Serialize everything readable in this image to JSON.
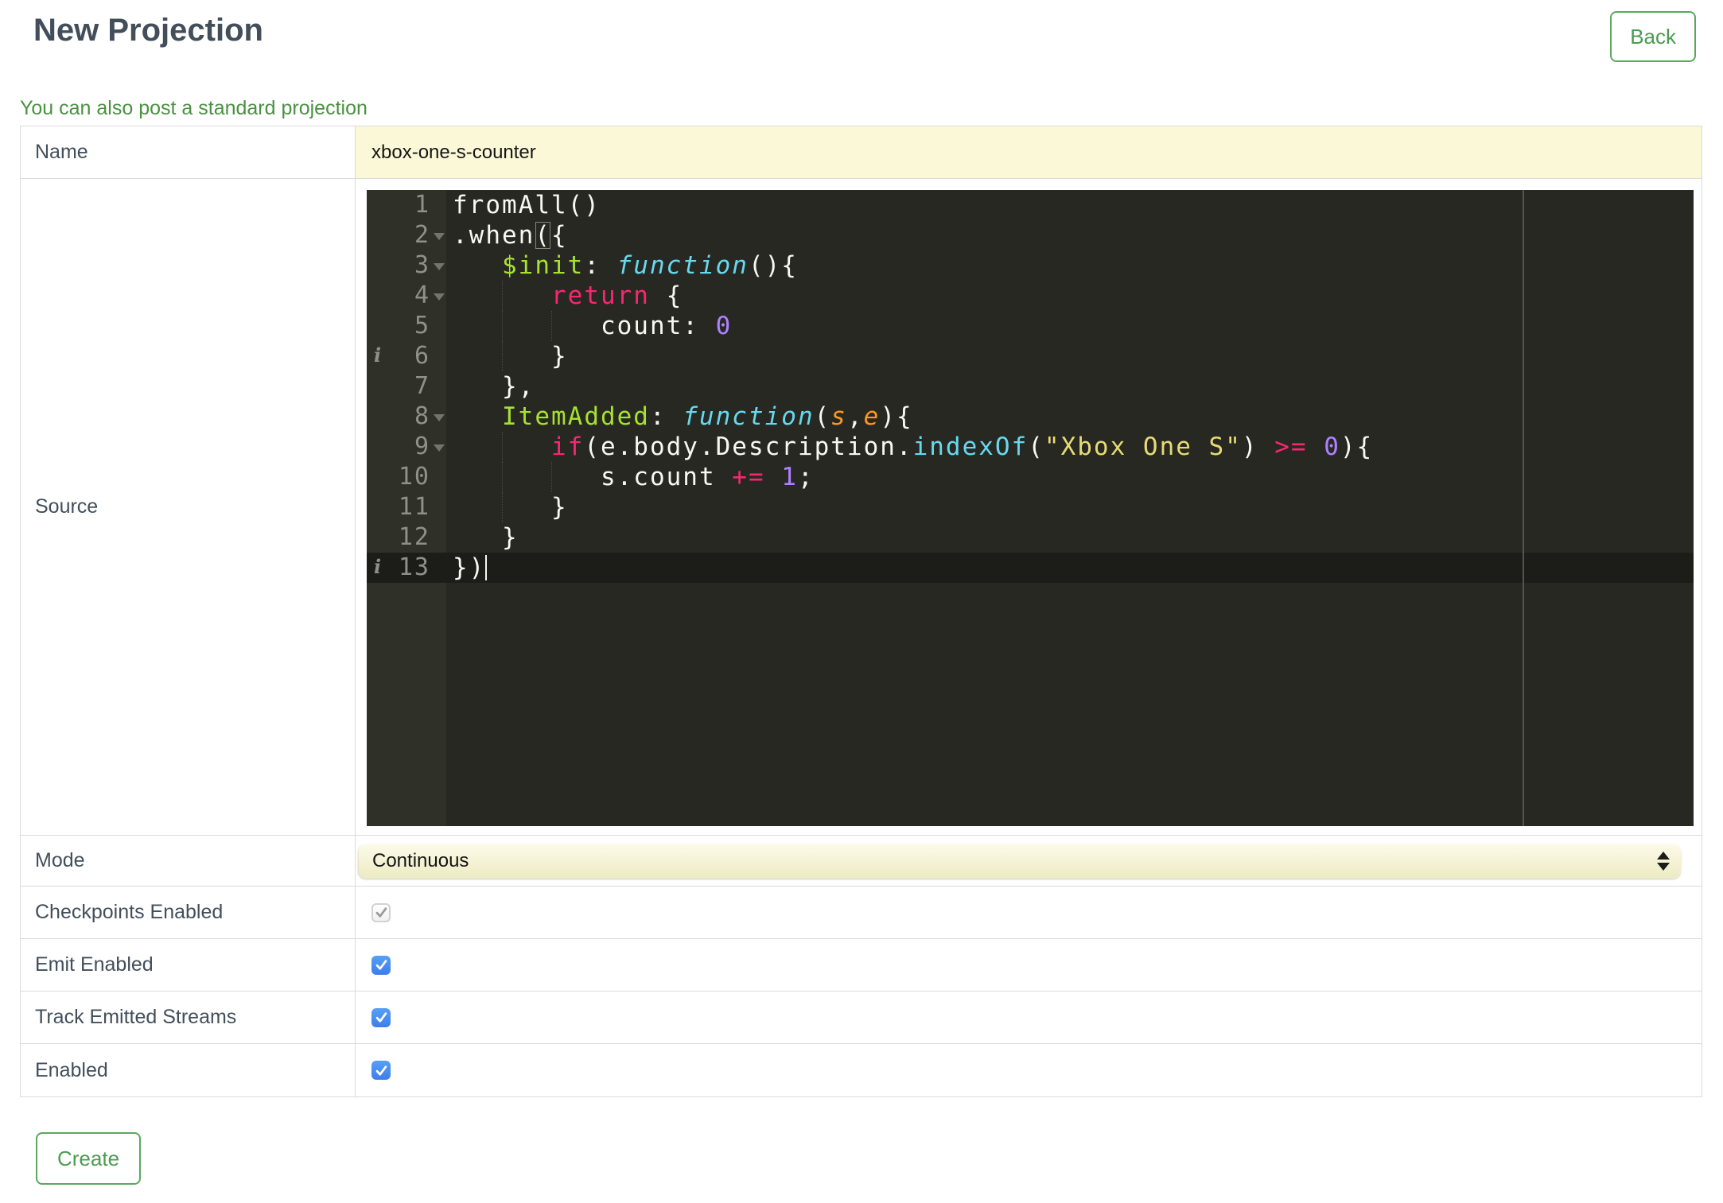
{
  "header": {
    "title": "New Projection",
    "back_label": "Back"
  },
  "subtitle_link": "You can also post a standard projection",
  "form": {
    "name": {
      "label": "Name",
      "value": "xbox-one-s-counter"
    },
    "source": {
      "label": "Source"
    },
    "mode": {
      "label": "Mode",
      "value": "Continuous"
    },
    "checkboxes": [
      {
        "label": "Checkpoints Enabled",
        "checked": true,
        "disabled": true
      },
      {
        "label": "Emit Enabled",
        "checked": true,
        "disabled": false
      },
      {
        "label": "Track Emitted Streams",
        "checked": true,
        "disabled": false
      },
      {
        "label": "Enabled",
        "checked": true,
        "disabled": false
      }
    ],
    "create_label": "Create"
  },
  "editor": {
    "lines": [
      {
        "num": 1,
        "segments": [
          [
            "p",
            "fromAll()"
          ]
        ]
      },
      {
        "num": 2,
        "fold": true,
        "segments": [
          [
            "p",
            ".when"
          ],
          [
            "brk",
            "("
          ],
          [
            "p",
            "{"
          ]
        ]
      },
      {
        "num": 3,
        "fold": true,
        "segments": [
          [
            "p",
            "   "
          ],
          [
            "name",
            "$init"
          ],
          [
            "p",
            ": "
          ],
          [
            "fn",
            "function"
          ],
          [
            "p",
            "(){"
          ]
        ]
      },
      {
        "num": 4,
        "fold": true,
        "guides": [
          3
        ],
        "segments": [
          [
            "p",
            "      "
          ],
          [
            "kw",
            "return"
          ],
          [
            "p",
            " {"
          ]
        ]
      },
      {
        "num": 5,
        "guides": [
          3,
          6
        ],
        "segments": [
          [
            "p",
            "         count: "
          ],
          [
            "num",
            "0"
          ]
        ]
      },
      {
        "num": 6,
        "info": true,
        "guides": [
          3
        ],
        "segments": [
          [
            "p",
            "      }"
          ]
        ]
      },
      {
        "num": 7,
        "segments": [
          [
            "p",
            "   },"
          ]
        ]
      },
      {
        "num": 8,
        "fold": true,
        "segments": [
          [
            "p",
            "   "
          ],
          [
            "name",
            "ItemAdded"
          ],
          [
            "p",
            ": "
          ],
          [
            "fn",
            "function"
          ],
          [
            "p",
            "("
          ],
          [
            "arg",
            "s"
          ],
          [
            "p",
            ","
          ],
          [
            "arg",
            "e"
          ],
          [
            "p",
            "){"
          ]
        ]
      },
      {
        "num": 9,
        "fold": true,
        "guides": [
          3
        ],
        "segments": [
          [
            "p",
            "      "
          ],
          [
            "kw",
            "if"
          ],
          [
            "p",
            "(e.body.Description."
          ],
          [
            "sup",
            "indexOf"
          ],
          [
            "p",
            "("
          ],
          [
            "str",
            "\"Xbox One S\""
          ],
          [
            "p",
            ") "
          ],
          [
            "kw",
            ">="
          ],
          [
            "p",
            " "
          ],
          [
            "num",
            "0"
          ],
          [
            "p",
            "){"
          ]
        ]
      },
      {
        "num": 10,
        "guides": [
          3,
          6
        ],
        "segments": [
          [
            "p",
            "         s.count "
          ],
          [
            "kw",
            "+="
          ],
          [
            "p",
            " "
          ],
          [
            "num",
            "1"
          ],
          [
            "p",
            ";"
          ]
        ]
      },
      {
        "num": 11,
        "guides": [
          3
        ],
        "segments": [
          [
            "p",
            "      }"
          ]
        ]
      },
      {
        "num": 12,
        "segments": [
          [
            "p",
            "   }"
          ]
        ]
      },
      {
        "num": 13,
        "info": true,
        "active": true,
        "segments": [
          [
            "p",
            "})"
          ],
          [
            "cursor",
            ""
          ]
        ]
      }
    ]
  },
  "theme": {
    "heading": "#424F5B",
    "green": "#4C9B50",
    "green-border": "#5CA75F",
    "link-green": "#4A9142",
    "cell-border": "#DBDBDB",
    "input-yellow": "#FAF8D6",
    "select-top": "#FCFBEA",
    "select-bottom": "#EDEBC2",
    "cb-top": "#57A0F6",
    "cb-bottom": "#3D7DEC",
    "editor-bg": "#272822",
    "gutter-bg": "#2F3129",
    "gutter-fg": "#8F908A",
    "active-line": "#1C1D18",
    "print-margin": "#53544C",
    "tok-plain": "#F8F8F2",
    "tok-kw": "#F92672",
    "tok-fn": "#66D9EF",
    "tok-name": "#A6E22E",
    "tok-arg": "#FD971F",
    "tok-num": "#AE81FF",
    "tok-str": "#E6DB74"
  }
}
